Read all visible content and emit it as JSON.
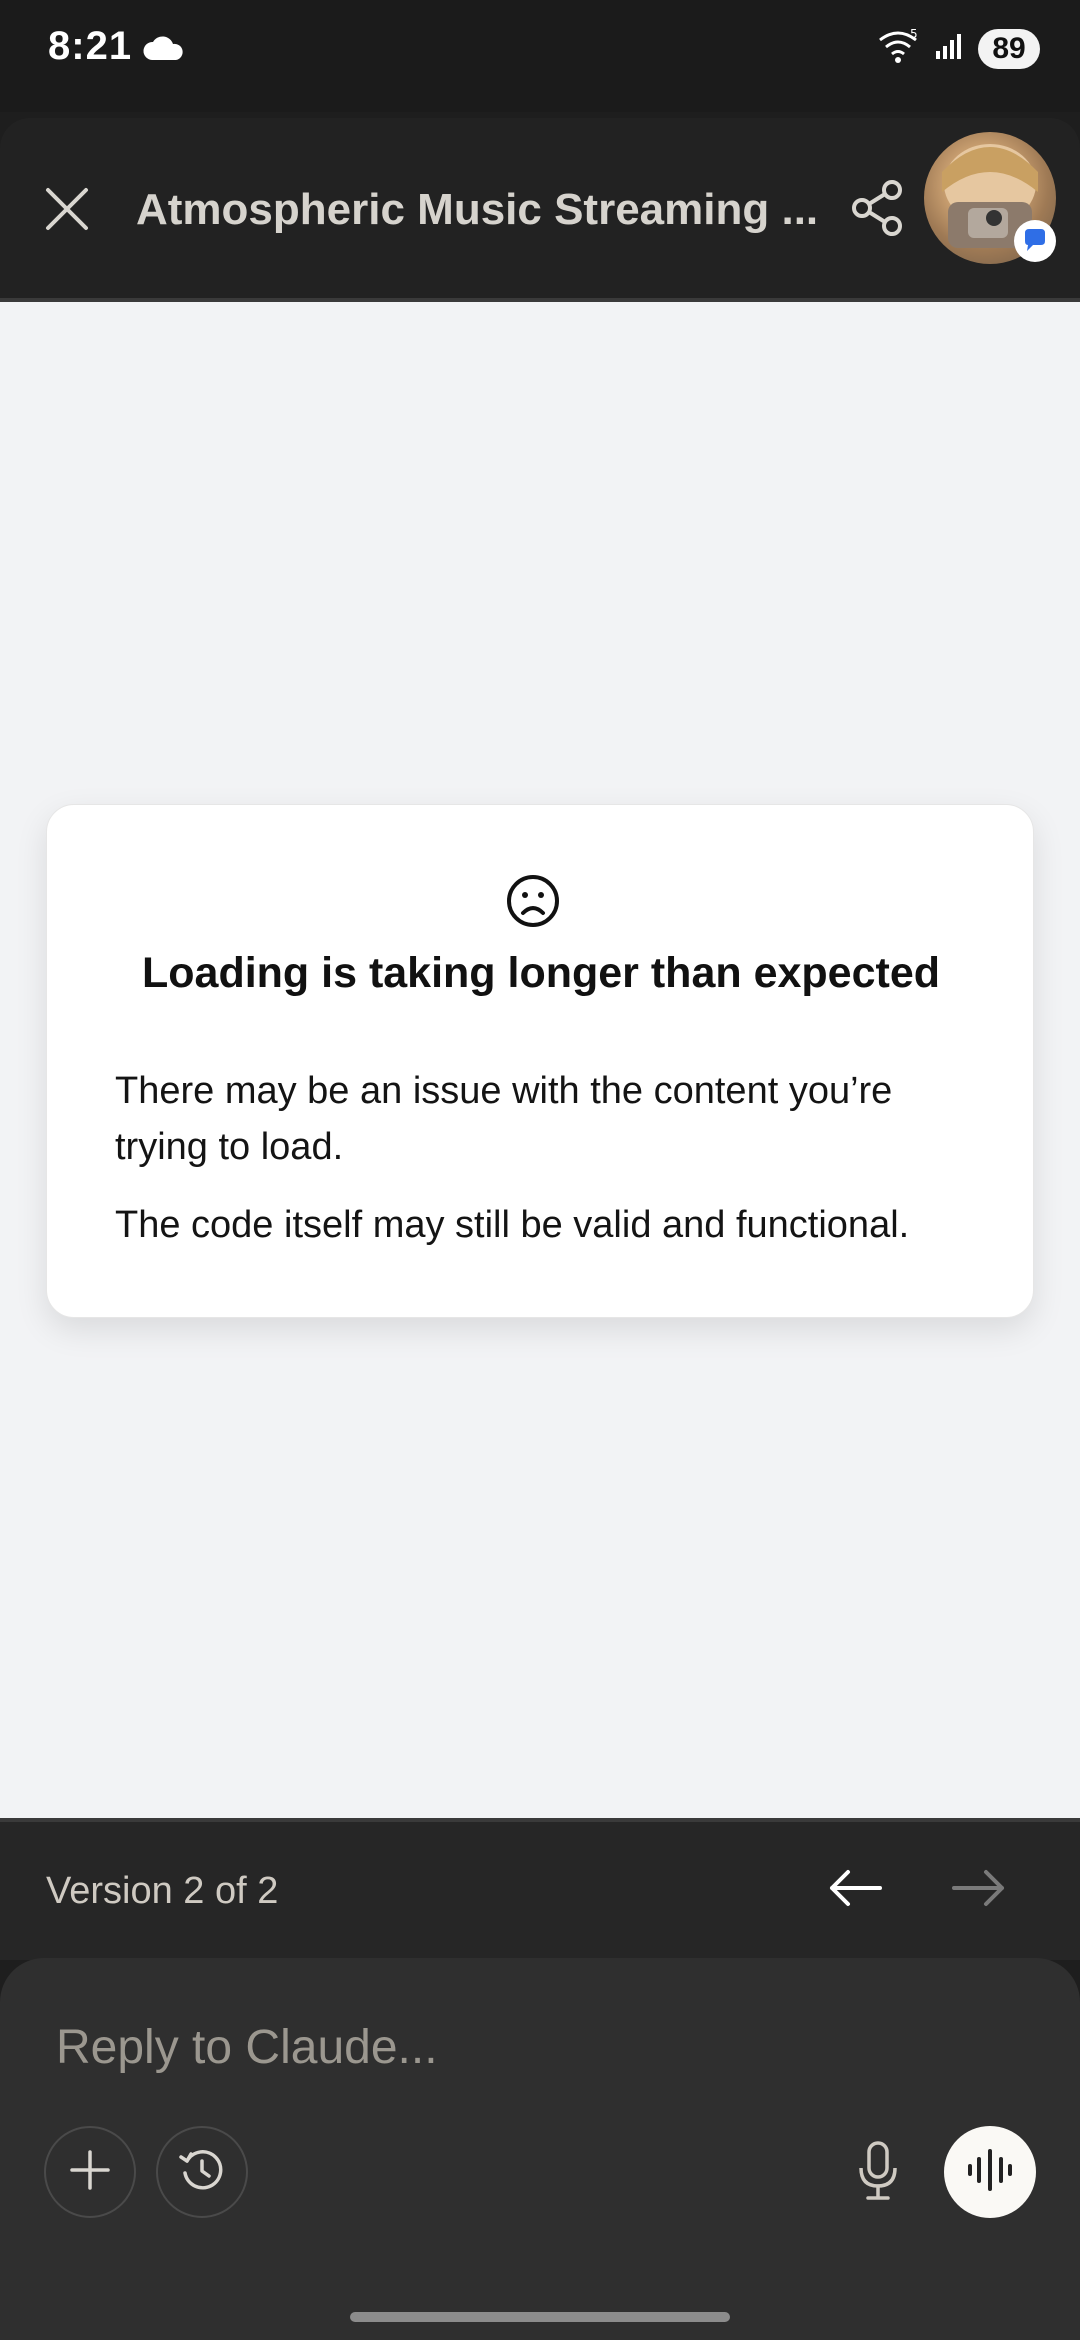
{
  "status_bar": {
    "time": "8:21",
    "battery": "89",
    "icons": [
      "cloud-icon",
      "wifi-icon",
      "signal-icon",
      "battery-icon"
    ]
  },
  "header": {
    "title": "Atmospheric Music Streaming ...",
    "icons": [
      "close-icon",
      "share-icon",
      "avatar",
      "chat-badge-icon"
    ]
  },
  "error_card": {
    "icon": "sad-face-icon",
    "title": "Loading is taking longer than expected",
    "paragraph_1": "There may be an issue with the content you’re trying to load.",
    "paragraph_2": "The code itself may still be valid and functional."
  },
  "version_bar": {
    "label": "Version 2 of 2",
    "icons": [
      "arrow-left-icon",
      "arrow-right-icon"
    ]
  },
  "composer": {
    "placeholder": "Reply to Claude...",
    "icons": [
      "plus-icon",
      "history-icon",
      "microphone-icon",
      "voice-waveform-icon"
    ]
  },
  "colors": {
    "background_dark": "#1e1e1e",
    "content_background": "#f2f3f5",
    "card_background": "#ffffff",
    "text_muted": "#d6d3cd",
    "voice_button": "#faf9f5"
  }
}
